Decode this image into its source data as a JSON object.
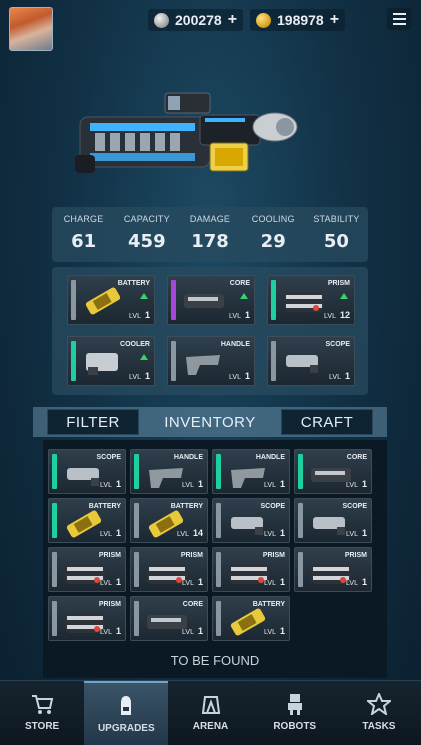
{
  "currency": {
    "silver": "200278",
    "gold": "198978",
    "plus": "+"
  },
  "stats": [
    {
      "label": "CHARGE",
      "value": "61"
    },
    {
      "label": "CAPACITY",
      "value": "459"
    },
    {
      "label": "DAMAGE",
      "value": "178"
    },
    {
      "label": "COOLING",
      "value": "29"
    },
    {
      "label": "STABILITY",
      "value": "50"
    }
  ],
  "equipped": [
    {
      "name": "BATTERY",
      "lvl_label": "LVL",
      "lvl": "1",
      "rarity": "grey",
      "upgrade": true
    },
    {
      "name": "CORE",
      "lvl_label": "LVL",
      "lvl": "1",
      "rarity": "purple",
      "upgrade": true
    },
    {
      "name": "PRISM",
      "lvl_label": "LVL",
      "lvl": "12",
      "rarity": "teal",
      "upgrade": true
    },
    {
      "name": "COOLER",
      "lvl_label": "LVL",
      "lvl": "1",
      "rarity": "teal",
      "upgrade": true
    },
    {
      "name": "HANDLE",
      "lvl_label": "LVL",
      "lvl": "1",
      "rarity": "grey",
      "upgrade": false
    },
    {
      "name": "SCOPE",
      "lvl_label": "LVL",
      "lvl": "1",
      "rarity": "grey",
      "upgrade": false
    }
  ],
  "tabs": {
    "filter": "FILTER",
    "inventory": "INVENTORY",
    "craft": "CRAFT"
  },
  "inventory": [
    {
      "name": "SCOPE",
      "lvl_label": "LVL",
      "lvl": "1",
      "rarity": "teal"
    },
    {
      "name": "HANDLE",
      "lvl_label": "LVL",
      "lvl": "1",
      "rarity": "teal"
    },
    {
      "name": "HANDLE",
      "lvl_label": "LVL",
      "lvl": "1",
      "rarity": "teal"
    },
    {
      "name": "CORE",
      "lvl_label": "LVL",
      "lvl": "1",
      "rarity": "teal"
    },
    {
      "name": "BATTERY",
      "lvl_label": "LVL",
      "lvl": "1",
      "rarity": "teal"
    },
    {
      "name": "BATTERY",
      "lvl_label": "LVL",
      "lvl": "14",
      "rarity": "grey"
    },
    {
      "name": "SCOPE",
      "lvl_label": "LVL",
      "lvl": "1",
      "rarity": "grey"
    },
    {
      "name": "SCOPE",
      "lvl_label": "LVL",
      "lvl": "1",
      "rarity": "grey"
    },
    {
      "name": "PRISM",
      "lvl_label": "LVL",
      "lvl": "1",
      "rarity": "grey"
    },
    {
      "name": "PRISM",
      "lvl_label": "LVL",
      "lvl": "1",
      "rarity": "grey"
    },
    {
      "name": "PRISM",
      "lvl_label": "LVL",
      "lvl": "1",
      "rarity": "grey"
    },
    {
      "name": "PRISM",
      "lvl_label": "LVL",
      "lvl": "1",
      "rarity": "grey"
    },
    {
      "name": "PRISM",
      "lvl_label": "LVL",
      "lvl": "1",
      "rarity": "grey"
    },
    {
      "name": "CORE",
      "lvl_label": "LVL",
      "lvl": "1",
      "rarity": "grey"
    },
    {
      "name": "BATTERY",
      "lvl_label": "LVL",
      "lvl": "1",
      "rarity": "grey"
    }
  ],
  "to_be_found": "TO BE FOUND",
  "nav": [
    {
      "label": "STORE",
      "icon": "cart-icon",
      "active": false
    },
    {
      "label": "UPGRADES",
      "icon": "bullet-icon",
      "active": true
    },
    {
      "label": "ARENA",
      "icon": "arena-icon",
      "active": false
    },
    {
      "label": "ROBOTS",
      "icon": "robot-icon",
      "active": false
    },
    {
      "label": "TASKS",
      "icon": "star-icon",
      "active": false
    }
  ]
}
